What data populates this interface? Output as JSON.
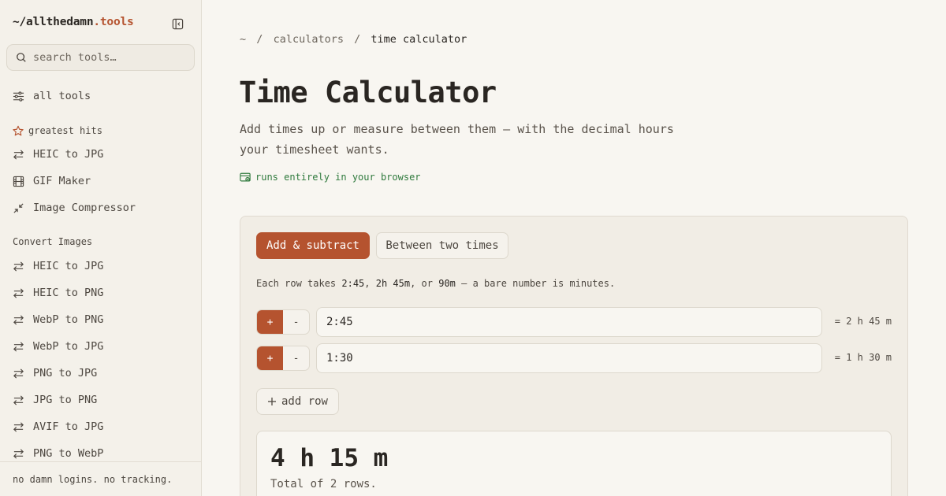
{
  "brand": {
    "prefix": "~/allthedamn",
    "suffix": ".tools"
  },
  "search": {
    "placeholder": "search tools…"
  },
  "nav": {
    "all_tools": "all tools"
  },
  "greatest_hits": {
    "label": "greatest hits",
    "items": [
      {
        "label": "HEIC to JPG",
        "icon": "arrows-swap-icon"
      },
      {
        "label": "GIF Maker",
        "icon": "film-icon"
      },
      {
        "label": "Image Compressor",
        "icon": "compress-icon"
      }
    ]
  },
  "convert_images": {
    "label": "Convert Images",
    "items": [
      {
        "label": "HEIC to JPG"
      },
      {
        "label": "HEIC to PNG"
      },
      {
        "label": "WebP to PNG"
      },
      {
        "label": "WebP to JPG"
      },
      {
        "label": "PNG to JPG"
      },
      {
        "label": "JPG to PNG"
      },
      {
        "label": "AVIF to JPG"
      },
      {
        "label": "PNG to WebP"
      }
    ]
  },
  "footer": {
    "text": "no damn logins. no tracking."
  },
  "breadcrumb": {
    "root": "~",
    "sep": "/",
    "parent": "calculators",
    "current": "time calculator"
  },
  "page": {
    "title": "Time Calculator",
    "subtitle": "Add times up or measure between them — with the decimal hours your timesheet wants.",
    "privacy_note": "runs entirely in your browser"
  },
  "tabs": [
    {
      "label": "Add & subtract",
      "active": true
    },
    {
      "label": "Between two times",
      "active": false
    }
  ],
  "hint": {
    "prefix": "Each row takes ",
    "ex1": "2:45",
    "comma1": ", ",
    "ex2": "2h 45m",
    "comma2": ", or ",
    "ex3": "90m",
    "suffix": " — a bare number is minutes."
  },
  "rows": [
    {
      "plus": "+",
      "minus": "-",
      "value": "2:45",
      "result": "= 2 h 45 m"
    },
    {
      "plus": "+",
      "minus": "-",
      "value": "1:30",
      "result": "= 1 h 30 m"
    }
  ],
  "add_row": {
    "label": "add row"
  },
  "result": {
    "total": "4 h 15 m",
    "caption": "Total of 2 rows."
  },
  "colors": {
    "accent": "#b5532f",
    "success": "#2f7a3d",
    "background": "#f8f6f1"
  }
}
